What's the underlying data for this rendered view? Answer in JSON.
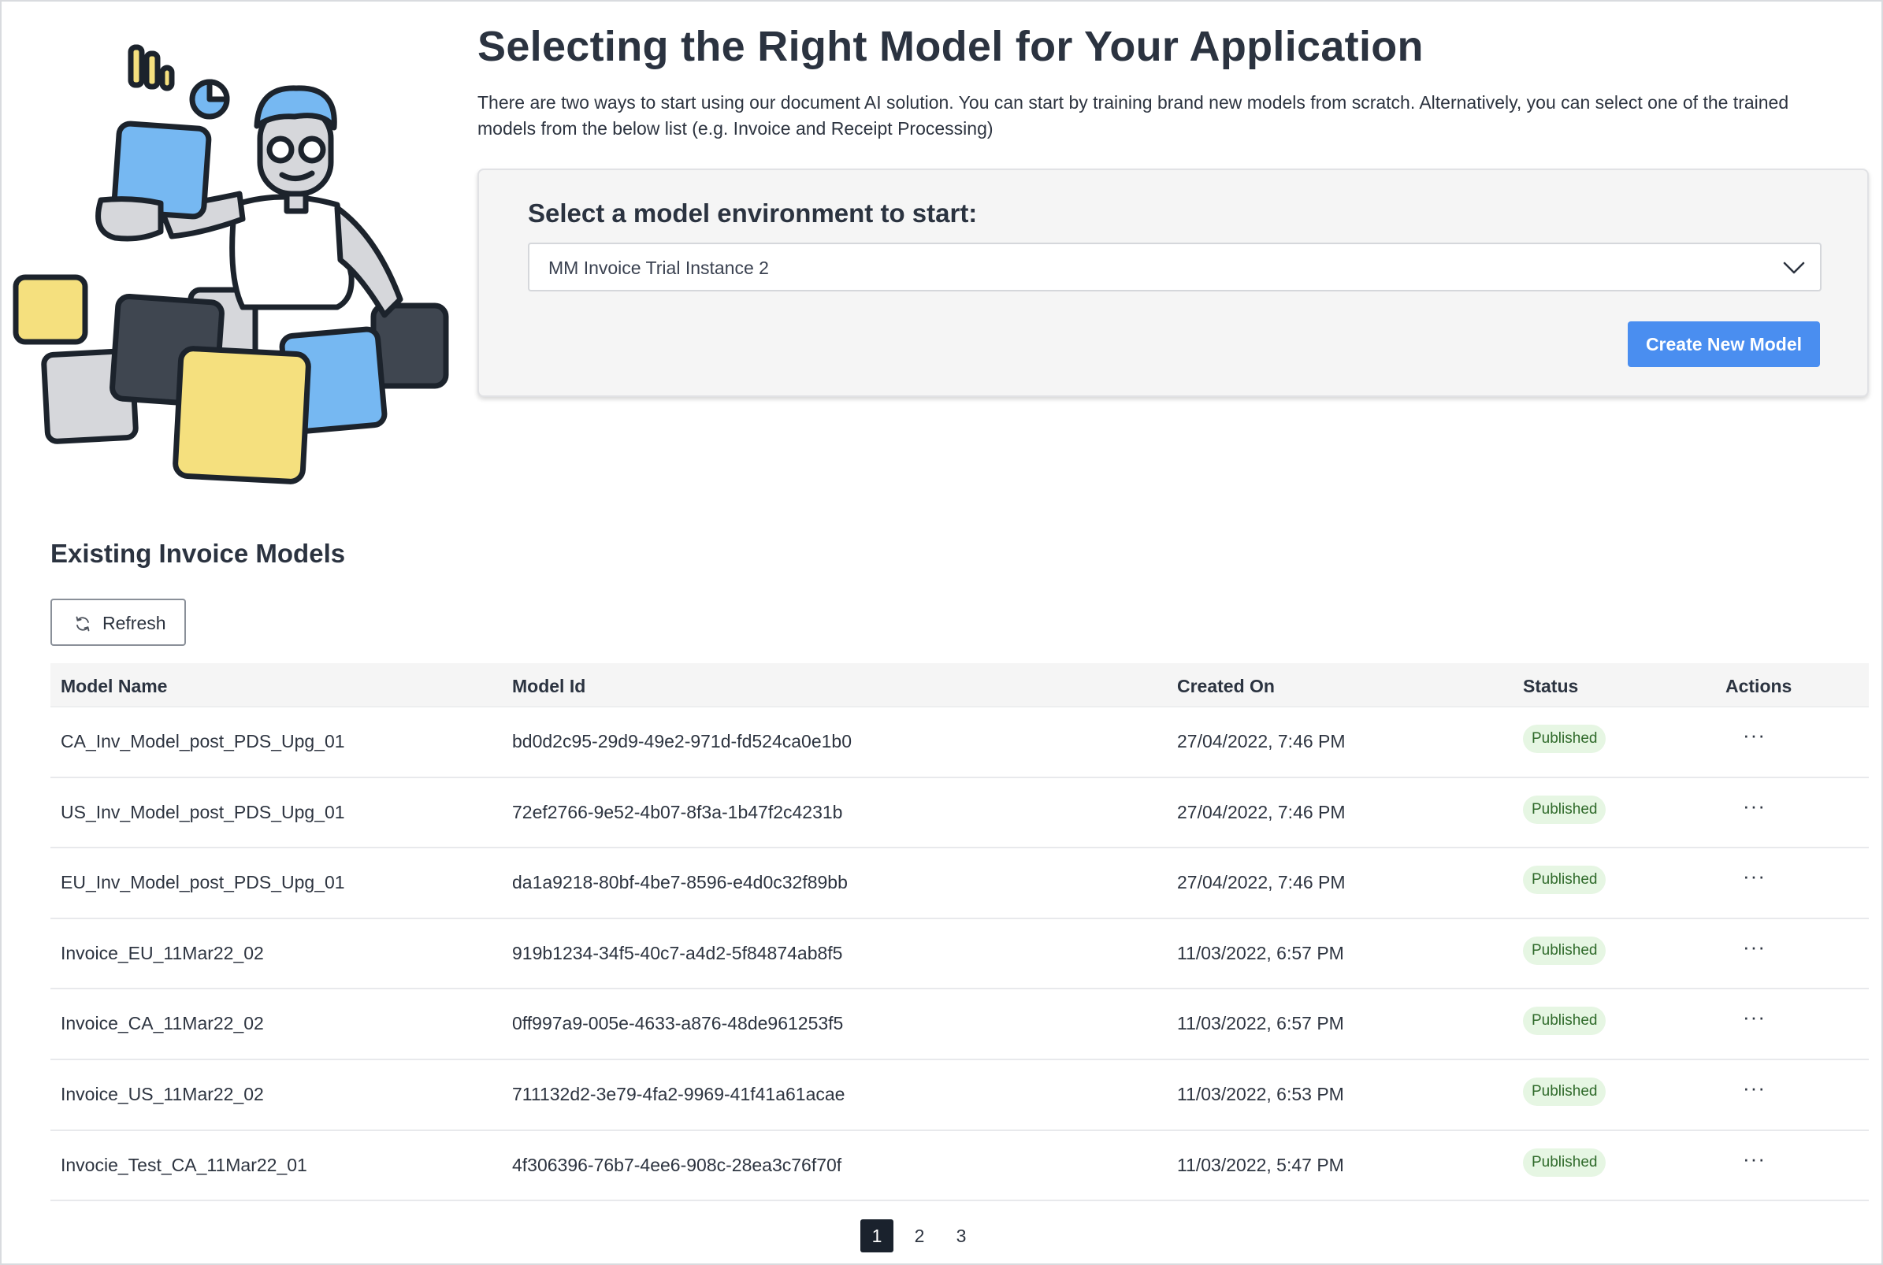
{
  "header": {
    "title": "Selecting the Right Model for Your Application",
    "intro": "There are two ways to start using our document AI solution. You can start by training brand new models from scratch. Alternatively, you can select one of the trained models from the below list (e.g. Invoice and Receipt Processing)"
  },
  "environment": {
    "label": "Select a model environment to start:",
    "selected": "MM Invoice Trial Instance 2",
    "create_button": "Create New Model"
  },
  "models": {
    "section_title": "Existing Invoice Models",
    "refresh_label": "Refresh",
    "columns": [
      "Model Name",
      "Model Id",
      "Created On",
      "Status",
      "Actions"
    ],
    "rows": [
      {
        "name": "CA_Inv_Model_post_PDS_Upg_01",
        "id": "bd0d2c95-29d9-49e2-971d-fd524ca0e1b0",
        "created": "27/04/2022, 7:46 PM",
        "status": "Published",
        "actions": "···"
      },
      {
        "name": "US_Inv_Model_post_PDS_Upg_01",
        "id": "72ef2766-9e52-4b07-8f3a-1b47f2c4231b",
        "created": "27/04/2022, 7:46 PM",
        "status": "Published",
        "actions": "···"
      },
      {
        "name": "EU_Inv_Model_post_PDS_Upg_01",
        "id": "da1a9218-80bf-4be7-8596-e4d0c32f89bb",
        "created": "27/04/2022, 7:46 PM",
        "status": "Published",
        "actions": "···"
      },
      {
        "name": "Invoice_EU_11Mar22_02",
        "id": "919b1234-34f5-40c7-a4d2-5f84874ab8f5",
        "created": "11/03/2022, 6:57 PM",
        "status": "Published",
        "actions": "···"
      },
      {
        "name": "Invoice_CA_11Mar22_02",
        "id": "0ff997a9-005e-4633-a876-48de961253f5",
        "created": "11/03/2022, 6:57 PM",
        "status": "Published",
        "actions": "···"
      },
      {
        "name": "Invoice_US_11Mar22_02",
        "id": "711132d2-3e79-4fa2-9969-41f41a61acae",
        "created": "11/03/2022, 6:53 PM",
        "status": "Published",
        "actions": "···"
      },
      {
        "name": "Invocie_Test_CA_11Mar22_01",
        "id": "4f306396-76b7-4ee6-908c-28ea3c76f70f",
        "created": "11/03/2022, 5:47 PM",
        "status": "Published",
        "actions": "···"
      }
    ]
  },
  "pagination": {
    "pages": [
      "1",
      "2",
      "3"
    ],
    "current": "1"
  },
  "colors": {
    "accent": "#4a8ef0",
    "badge_bg": "#e6f6e3",
    "badge_text": "#2f6a2a",
    "active_page": "#1a222d"
  },
  "icons": {
    "select_chevron": "chevron-down-icon",
    "refresh": "refresh-icon",
    "illustration": "person-with-cards-illustration"
  }
}
